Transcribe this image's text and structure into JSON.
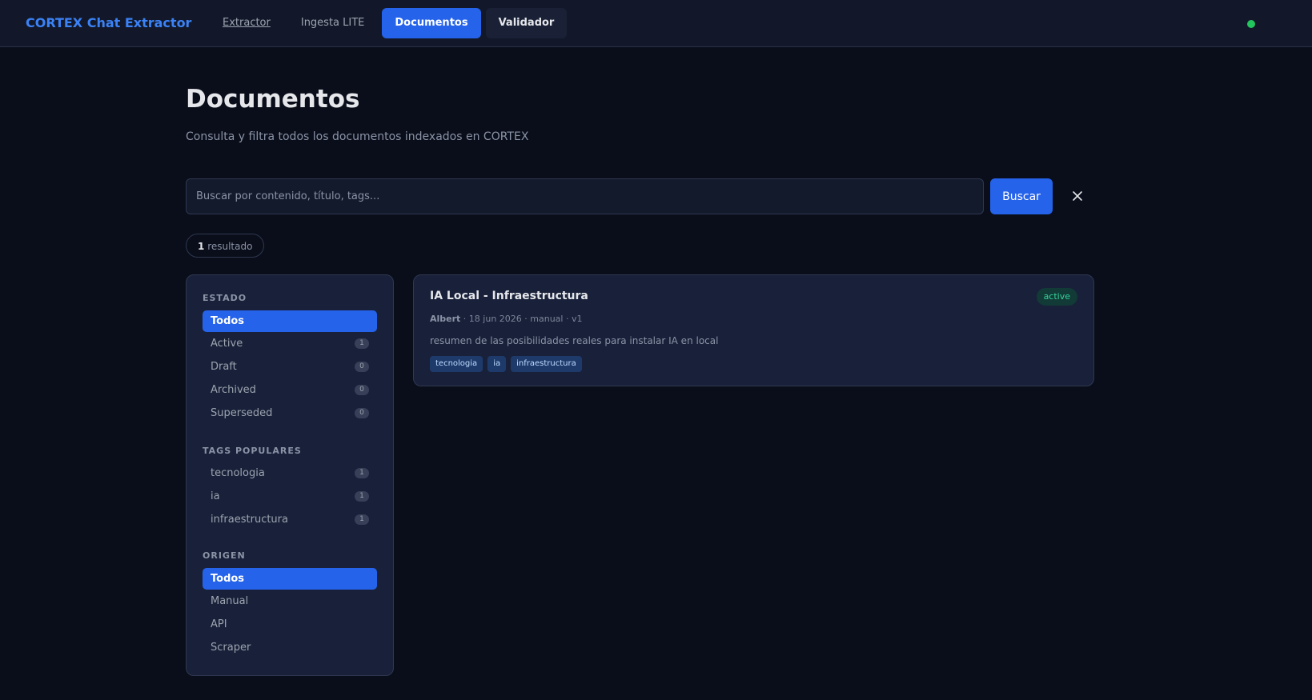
{
  "app": {
    "brand": "CORTEX Chat Extractor"
  },
  "nav": {
    "items": [
      {
        "label": "Extractor"
      },
      {
        "label": "Ingesta LITE"
      },
      {
        "label": "Documentos"
      },
      {
        "label": "Validador"
      }
    ],
    "active": "Documentos"
  },
  "status": {
    "color": "#22c55e"
  },
  "page": {
    "title": "Documentos",
    "subtitle": "Consulta y filtra todos los documentos indexados en CORTEX"
  },
  "search": {
    "placeholder": "Buscar por contenido, título, tags...",
    "value": "",
    "button_label": "Buscar",
    "clear_icon": "close-icon"
  },
  "results": {
    "count": "1",
    "label": "resultado"
  },
  "filters": {
    "estado": {
      "heading": "ESTADO",
      "items": [
        {
          "label": "Todos",
          "count": ""
        },
        {
          "label": "Active",
          "count": "1"
        },
        {
          "label": "Draft",
          "count": "0"
        },
        {
          "label": "Archived",
          "count": "0"
        },
        {
          "label": "Superseded",
          "count": "0"
        }
      ]
    },
    "tags": {
      "heading": "TAGS POPULARES",
      "items": [
        {
          "label": "tecnologia",
          "count": "1"
        },
        {
          "label": "ia",
          "count": "1"
        },
        {
          "label": "infraestructura",
          "count": "1"
        }
      ]
    },
    "origen": {
      "heading": "ORIGEN",
      "items": [
        {
          "label": "Todos"
        },
        {
          "label": "Manual"
        },
        {
          "label": "API"
        },
        {
          "label": "Scraper"
        }
      ]
    }
  },
  "documents": [
    {
      "title": "IA Local - Infraestructura",
      "status": "active",
      "author": "Albert",
      "meta": " · 18 jun 2026 · manual · v1",
      "summary": "resumen de las posibilidades reales para instalar IA en local",
      "tags": [
        "tecnologia",
        "ia",
        "infraestructura"
      ]
    }
  ],
  "colors": {
    "accent": "#2563eb",
    "brand": "#3b82f6",
    "status_active": "#34d399",
    "background": "#0a0e1a",
    "panel": "#19213a"
  }
}
